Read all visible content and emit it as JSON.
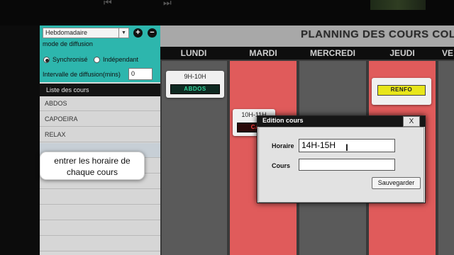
{
  "media": {
    "prev_icon": "skip-back-icon",
    "next_icon": "skip-forward-icon"
  },
  "sidebar": {
    "period_select": "Hebdomadaire",
    "add_icon": "+",
    "remove_icon": "−",
    "diffusion_mode_label": "mode de diffusion",
    "radio_sync": "Synchronisé",
    "radio_indep": "Indépendant",
    "interval_label": "Intervalle de diffusion(mins)",
    "interval_value": "0",
    "list_header": "Liste des cours",
    "courses": [
      "ABDOS",
      "CAPOEIRA",
      "RELAX",
      "",
      "",
      "",
      "",
      "",
      "",
      ""
    ]
  },
  "calendar": {
    "title": "PLANNING DES COURS COLL",
    "days": [
      "LUNDI",
      "MARDI",
      "MERCREDI",
      "JEUDI",
      "VE"
    ],
    "slots": [
      {
        "time": "9H-10H",
        "course": "ABDOS"
      },
      {
        "time": "10H-11H",
        "course": "CA"
      },
      {
        "time": "",
        "course": "RENFO"
      }
    ]
  },
  "tooltip": {
    "line1": "entrer les horaire de",
    "line2": "chaque cours"
  },
  "dialog": {
    "title": "Edition cours",
    "close": "X",
    "horaire_label": "Horaire",
    "horaire_value": "14H-15H",
    "cours_label": "Cours",
    "cours_value": "",
    "save": "Sauvegarder"
  },
  "colors": {
    "teal": "#2db6ad",
    "red_column": "#e05b5b",
    "dark": "#0e0e0e"
  }
}
